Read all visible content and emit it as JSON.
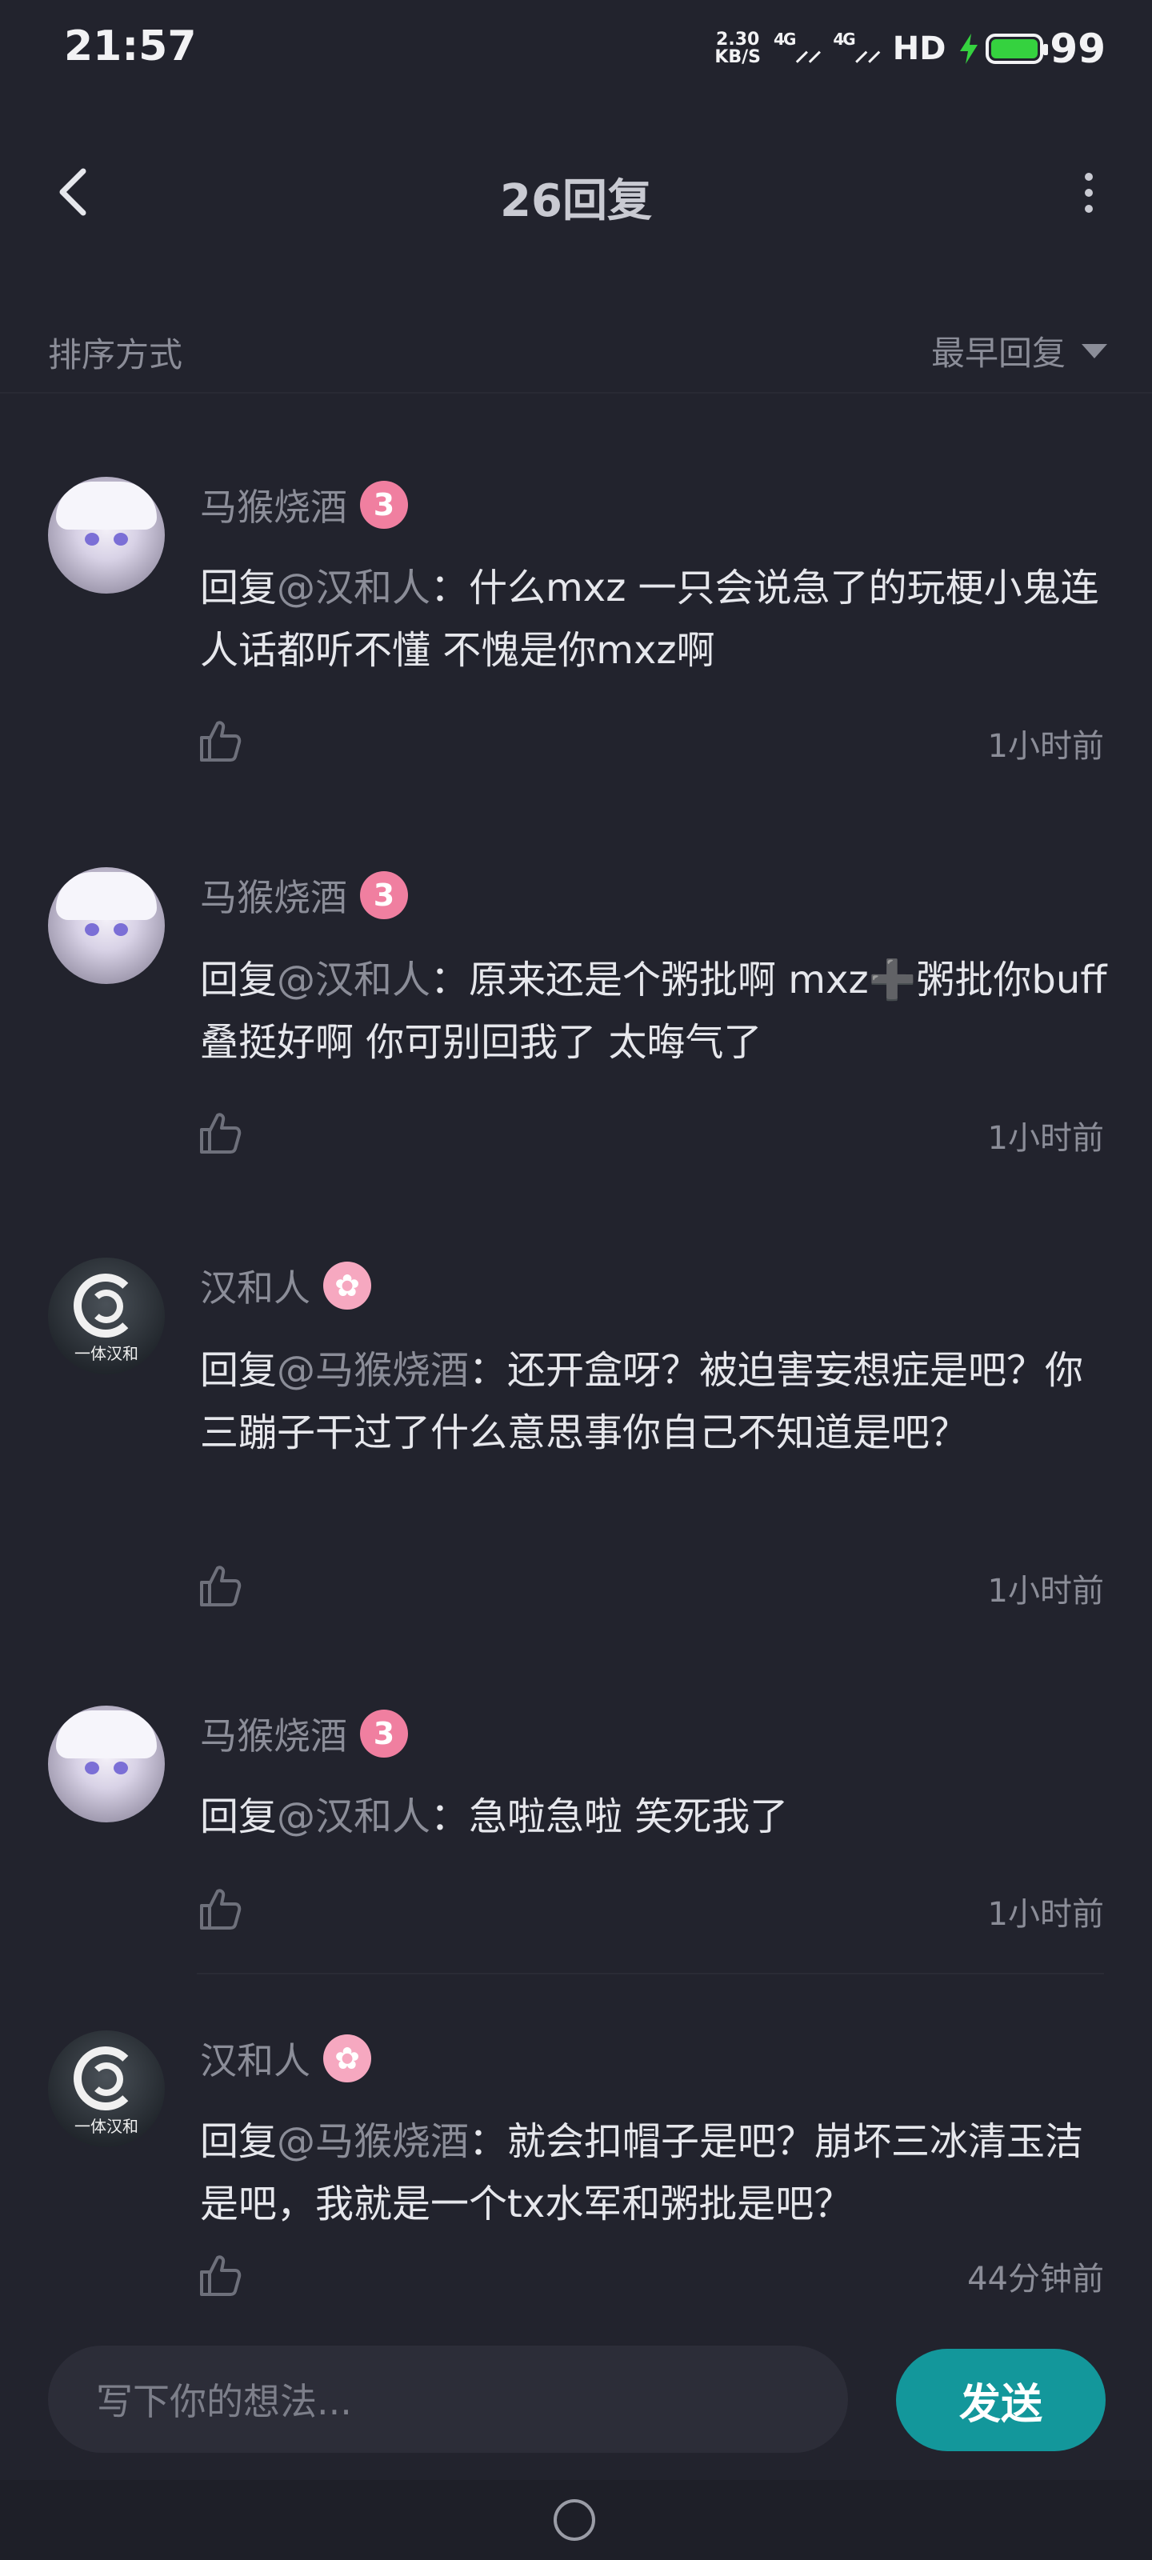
{
  "status_bar": {
    "time": "21:57",
    "net_speed_value": "2.30",
    "net_speed_unit": "KB/S",
    "signal_1": "4G",
    "signal_2": "4G",
    "hd_label": "HD",
    "battery_level": "99"
  },
  "header": {
    "title": "26回复",
    "back_icon": "chevron-left-icon",
    "more_icon": "more-vertical-icon"
  },
  "sort": {
    "label": "排序方式",
    "selected": "最早回复"
  },
  "comments": [
    {
      "username": "马猴烧酒",
      "badge": "3",
      "reply_prefix": "回复",
      "mention": "@汉和人",
      "separator": "：",
      "text": "什么mxz 一只会说急了的玩梗小鬼连人话都听不懂 不愧是你mxz啊",
      "time": "1小时前"
    },
    {
      "username": "马猴烧酒",
      "badge": "3",
      "reply_prefix": "回复",
      "mention": "@汉和人",
      "separator": "：",
      "text": "原来还是个粥批啊 mxz➕粥批你buff叠挺好啊 你可别回我了 太晦气了",
      "time": "1小时前"
    },
    {
      "username": "汉和人",
      "badge": "",
      "reply_prefix": "回复",
      "mention": "@马猴烧酒",
      "separator": "：",
      "text": "还开盒呀？被迫害妄想症是吧？你三蹦子干过了什么意思事你自己不知道是吧？",
      "time": "1小时前",
      "avatar_text": "一体汉和"
    },
    {
      "username": "马猴烧酒",
      "badge": "3",
      "reply_prefix": "回复",
      "mention": "@汉和人",
      "separator": "：",
      "text": "急啦急啦 笑死我了",
      "time": "1小时前"
    },
    {
      "username": "汉和人",
      "badge": "",
      "reply_prefix": "回复",
      "mention": "@马猴烧酒",
      "separator": "：",
      "text": "就会扣帽子是吧？崩坏三冰清玉洁是吧，我就是一个tx水军和粥批是吧？",
      "time": "44分钟前",
      "avatar_text": "一体汉和"
    }
  ],
  "input": {
    "placeholder": "写下你的想法...",
    "send_label": "发送"
  },
  "colors": {
    "background": "#22232d",
    "accent": "#13979b",
    "badge_pink": "#f07fa0"
  }
}
